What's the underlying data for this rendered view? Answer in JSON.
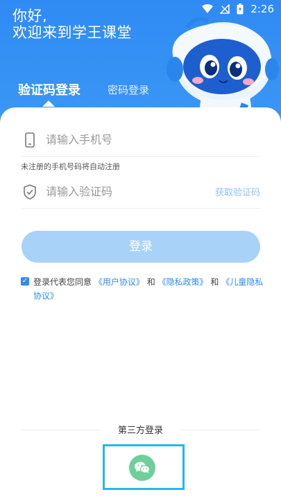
{
  "status_bar": {
    "time": "2:26"
  },
  "header": {
    "greeting_line1": "你好,",
    "greeting_line2": "欢迎来到学王课堂"
  },
  "tabs": [
    {
      "label": "验证码登录",
      "active": true
    },
    {
      "label": "密码登录",
      "active": false
    }
  ],
  "form": {
    "phone_placeholder": "请输入手机号",
    "hint": "未注册的手机号码将自动注册",
    "code_placeholder": "请输入验证码",
    "get_code_label": "获取验证码",
    "login_label": "登录"
  },
  "agreement": {
    "prefix": "登录代表您同意",
    "user_agreement": "《用户协议》",
    "and1": "和",
    "privacy_policy": "《隐私政策》",
    "and2": "和",
    "child_privacy": "《儿童隐私协议》"
  },
  "third_party": {
    "label": "第三方登录"
  },
  "colors": {
    "primary": "#2f8bf3",
    "button_disabled": "#a9d2f8",
    "wechat": "#6fcf9b",
    "highlight": "#22b8ea"
  }
}
